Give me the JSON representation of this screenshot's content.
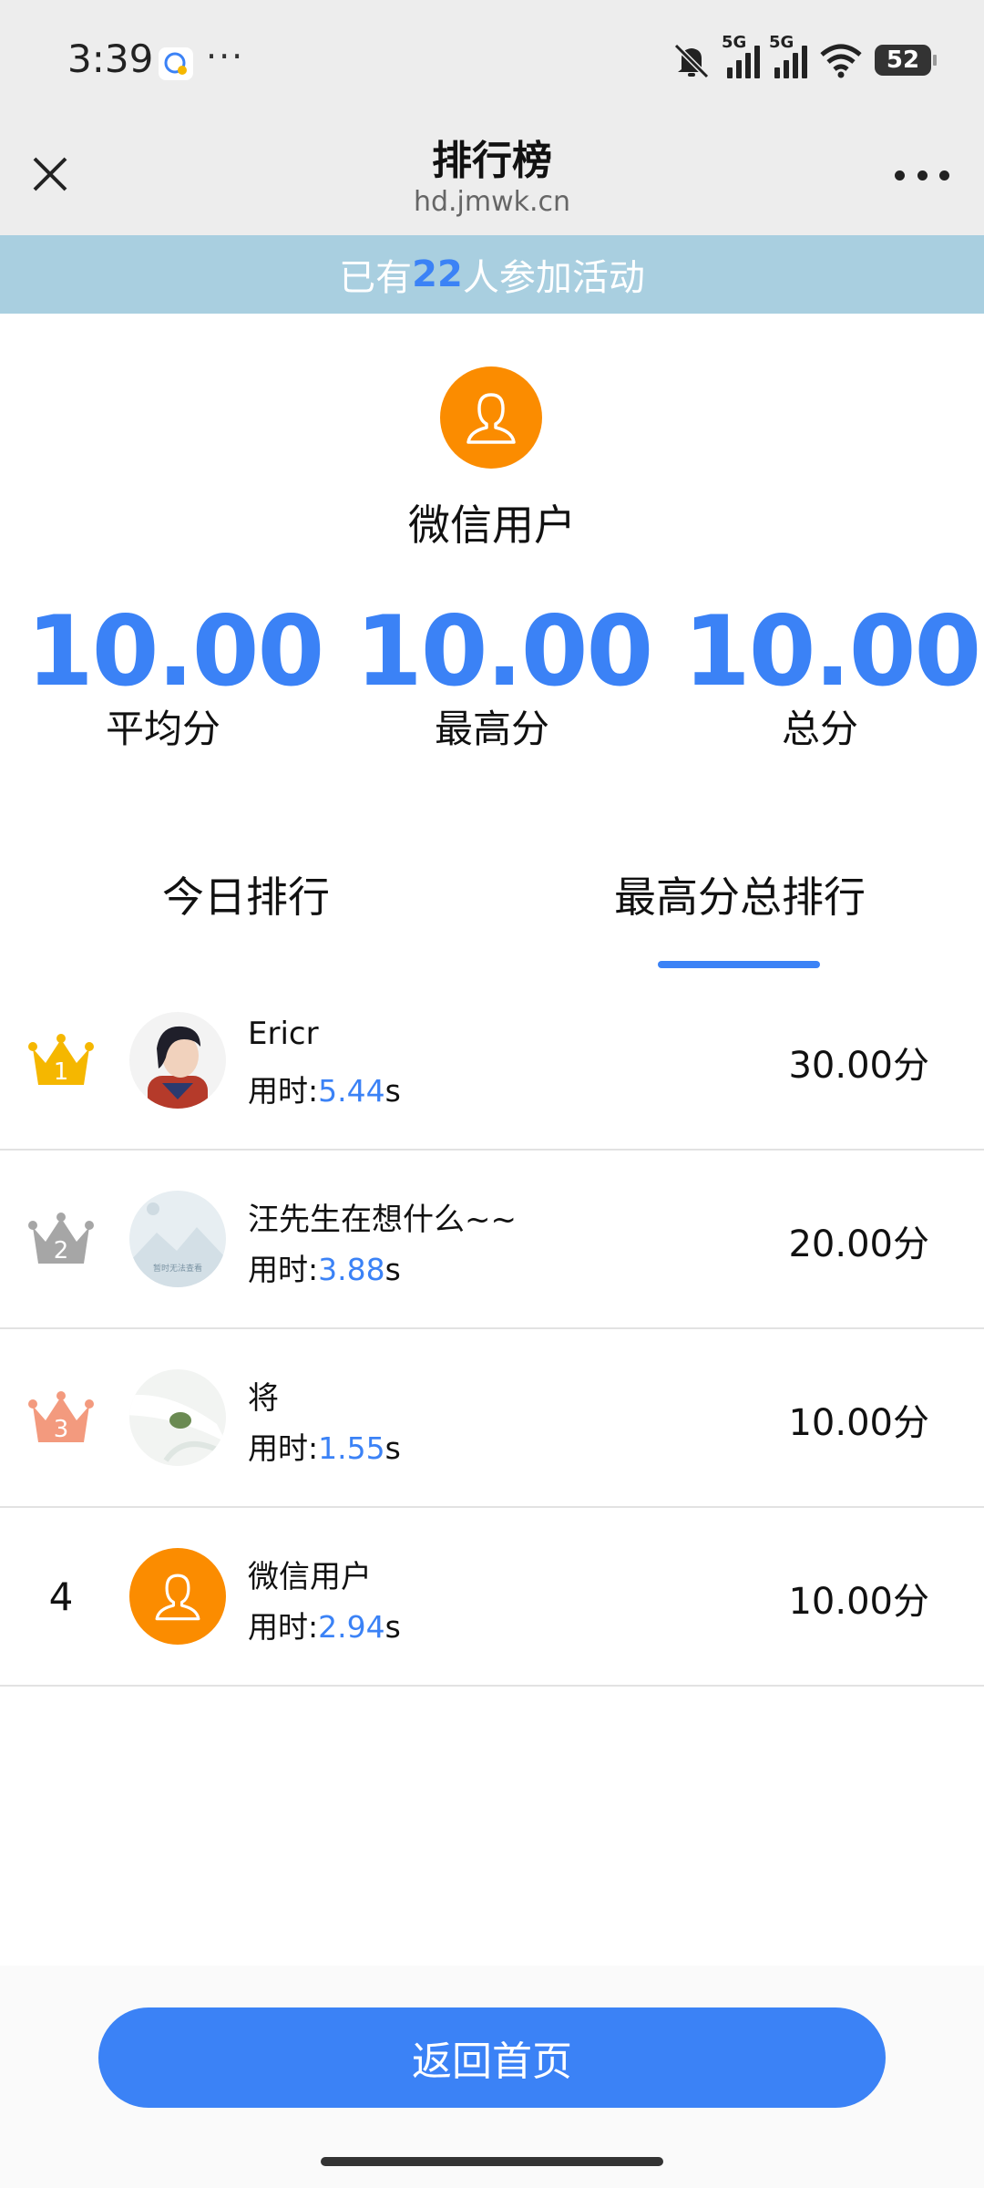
{
  "status_bar": {
    "time": "3:39",
    "app_icon": "chat-bubble-icon",
    "dots": "···",
    "network1": "5G",
    "network2": "5G",
    "battery": "52"
  },
  "header": {
    "title": "排行榜",
    "subtitle": "hd.jmwk.cn"
  },
  "banner": {
    "prefix": "已有",
    "count": "22",
    "suffix": "人参加活动"
  },
  "profile": {
    "name": "微信用户"
  },
  "stats": [
    {
      "value": "10.00",
      "label": "平均分"
    },
    {
      "value": "10.00",
      "label": "最高分"
    },
    {
      "value": "10.00",
      "label": "总分"
    }
  ],
  "tabs": {
    "today": "今日排行",
    "total": "最高分总排行",
    "active": "total"
  },
  "time_prefix": "用时:",
  "time_suffix": "s",
  "ranking": [
    {
      "rank": "1",
      "name": "Ericr",
      "time": "5.44",
      "score": "30.00分"
    },
    {
      "rank": "2",
      "name": "汪先生在想什么~~",
      "time": "3.88",
      "score": "20.00分"
    },
    {
      "rank": "3",
      "name": "将",
      "time": "1.55",
      "score": "10.00分"
    },
    {
      "rank": "4",
      "name": "微信用户",
      "time": "2.94",
      "score": "10.00分"
    }
  ],
  "avatar_placeholder_text": "暂时无法查看",
  "home_button": "返回首页",
  "colors": {
    "accent": "#3b82f6",
    "banner": "#a9cfe0",
    "avatar_orange": "#fb8c00",
    "gold": "#f5b700",
    "silver": "#a6a6a6",
    "bronze": "#f39a7e"
  }
}
